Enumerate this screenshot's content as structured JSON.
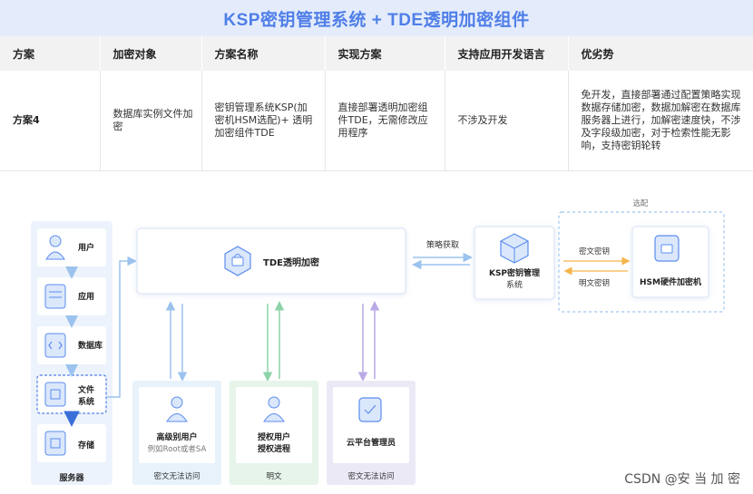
{
  "title": "KSP密钥管理系统 + TDE透明加密组件",
  "table": {
    "headers": [
      "方案",
      "加密对象",
      "方案名称",
      "实现方案",
      "支持应用开发语言",
      "优劣势"
    ],
    "row": {
      "scheme": "方案4",
      "target": "数据库实例文件加密",
      "name": "密钥管理系统KSP(加密机HSM选配)+ 透明加密组件TDE",
      "implementation": "直接部署透明加密组件TDE，无需修改应用程序",
      "languages": "不涉及开发",
      "pros_cons": "免开发，直接部署通过配置策略实现数据存储加密，数据加解密在数据库服务器上进行，加解密速度快，不涉及字段级加密，对于检索性能无影响，支持密钥轮转"
    }
  },
  "diagram": {
    "server_stack": {
      "items": [
        {
          "label": "用户",
          "icon": "user-icon"
        },
        {
          "label": "应用",
          "icon": "app-icon"
        },
        {
          "label": "数据库",
          "icon": "code-icon"
        },
        {
          "label_line1": "文件",
          "label_line2": "系统",
          "icon": "file-system-icon"
        },
        {
          "label": "存储",
          "icon": "storage-icon"
        }
      ],
      "footer": "服务器"
    },
    "tde": {
      "label": "TDE透明加密",
      "icon": "lock-cube-icon"
    },
    "policy_label": "策略获取",
    "ksp": {
      "label_line1": "KSP密钥管理",
      "label_line2": "系统",
      "icon": "ksp-icon"
    },
    "hsm": {
      "label": "HSM硬件加密机",
      "icon": "hsm-icon",
      "optional_label": "选配"
    },
    "ciphertext_key": "密文密钥",
    "plaintext_key": "明文密钥",
    "access_groups": [
      {
        "line1": "高级别用户",
        "line2": "例如Root或者SA",
        "footer": "密文无法访问",
        "color": "#e7f2fb"
      },
      {
        "line1": "授权用户",
        "line2": "授权进程",
        "footer": "明文",
        "color": "#e6f4ea"
      },
      {
        "line1": "云平台管理员",
        "line2": "",
        "footer": "密文无法访问",
        "color": "#ece9f7"
      }
    ],
    "colors": {
      "accent": "#4f7ee8",
      "icon_blue": "#5b8def",
      "arrow_blue": "#9cc3ee",
      "arrow_orange": "#f5b54a",
      "arrow_green": "#8cd3a7",
      "arrow_purple": "#b9a9e6"
    }
  },
  "watermark": "CSDN @安 当 加 密"
}
